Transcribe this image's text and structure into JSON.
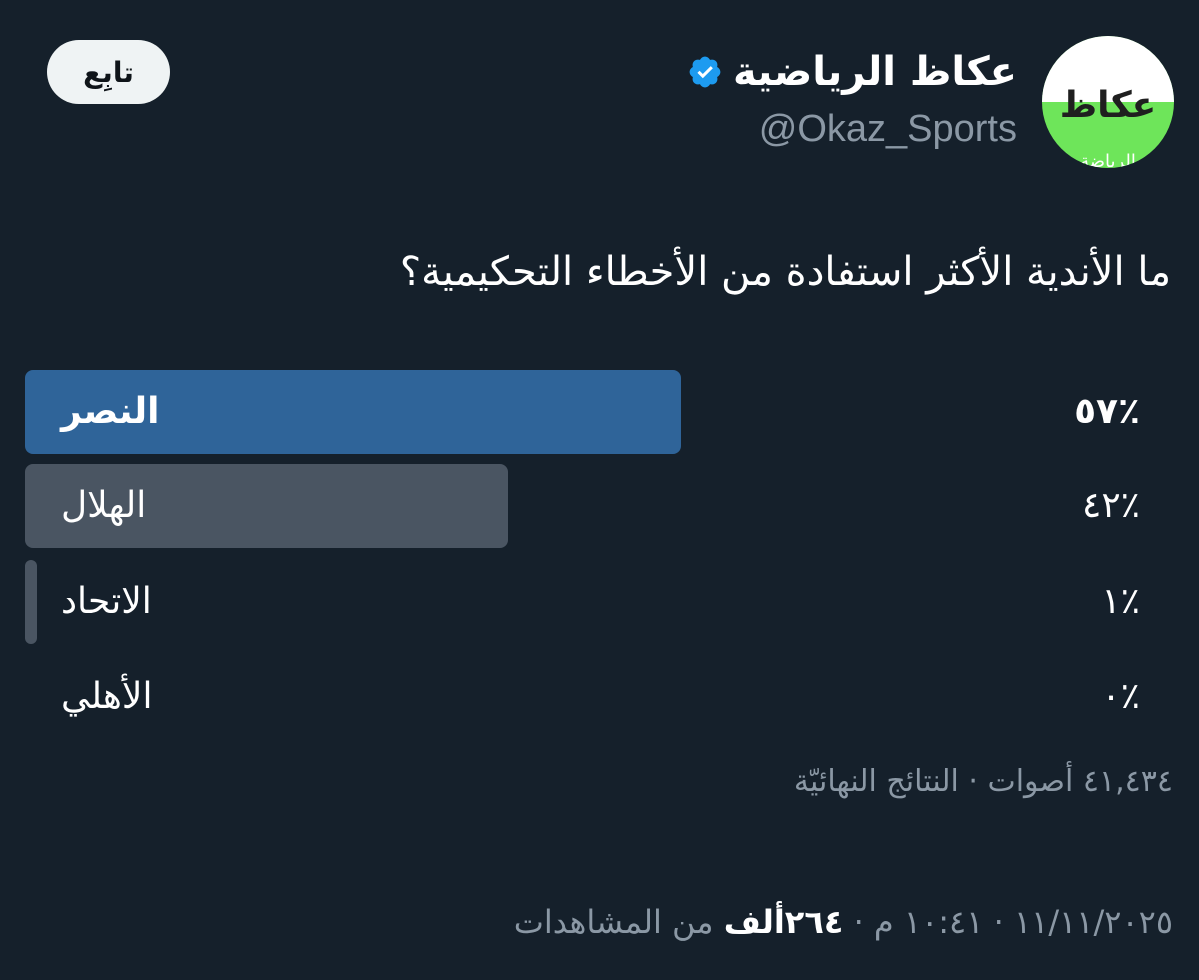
{
  "account": {
    "display_name": "عكاظ الرياضية",
    "handle": "@Okaz_Sports",
    "avatar_logo_text": "عكاظ",
    "avatar_sub_text": "الرياضة",
    "verified_icon": "verified-badge-icon",
    "verified_color": "#1d9bf0"
  },
  "follow_button": {
    "label": "تابِع"
  },
  "tweet": {
    "question": "ما الأندية الأكثر استفادة من الأخطاء التحكيمية؟"
  },
  "poll": {
    "options": [
      {
        "label": "النصر",
        "percent_label": "٪٥٧",
        "value": 57,
        "winner": true,
        "color": "#2f6499"
      },
      {
        "label": "الهلال",
        "percent_label": "٪٤٢",
        "value": 42,
        "winner": false,
        "color": "#4a5562"
      },
      {
        "label": "الاتحاد",
        "percent_label": "٪١",
        "value": 1,
        "winner": false,
        "color": "#4a5562"
      },
      {
        "label": "الأهلي",
        "percent_label": "٪٠",
        "value": 0,
        "winner": false,
        "color": "#4a5562"
      }
    ],
    "summary": "٤١,٤٣٤ أصوات · النتائج النهائيّة"
  },
  "meta": {
    "date_time": "١١/١١/٢٠٢٥ · ١٠:٤١ م · ",
    "views_count": "٢٦٤ألف",
    "views_suffix": " من المشاهدات"
  },
  "colors": {
    "background": "#15202b",
    "muted_text": "#8b98a5",
    "winner_bar": "#2f6499",
    "other_bar": "#4a5562"
  }
}
